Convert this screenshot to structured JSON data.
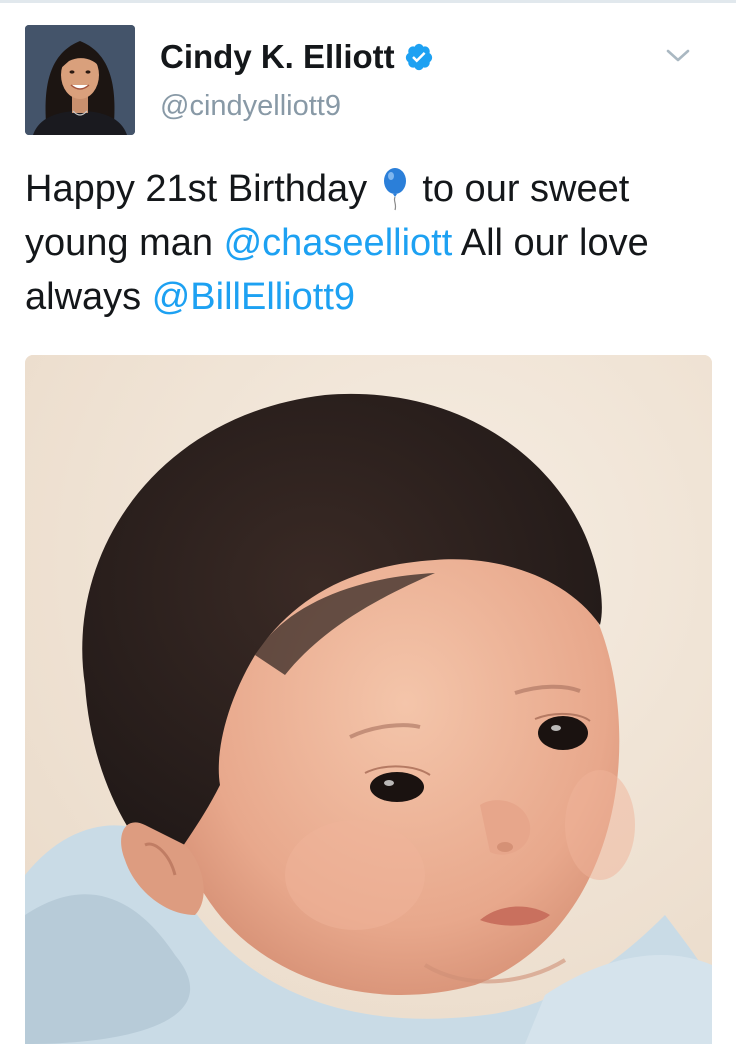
{
  "tweet": {
    "author": {
      "display_name": "Cindy K. Elliott",
      "handle": "@cindyelliott9",
      "verified": true,
      "avatar_icon": "profile-photo"
    },
    "menu_icon": "chevron-down-icon",
    "text": {
      "part1": "Happy 21st Birthday",
      "emoji": "balloon",
      "part2": "to our sweet young man",
      "mention1": "@chaseelliott",
      "part3": "All our love always",
      "mention2": "@BillElliott9"
    },
    "media": {
      "type": "photo"
    }
  },
  "colors": {
    "link": "#1da1f2",
    "text": "#14171a",
    "muted": "#8899a6",
    "verified": "#1da1f2"
  }
}
